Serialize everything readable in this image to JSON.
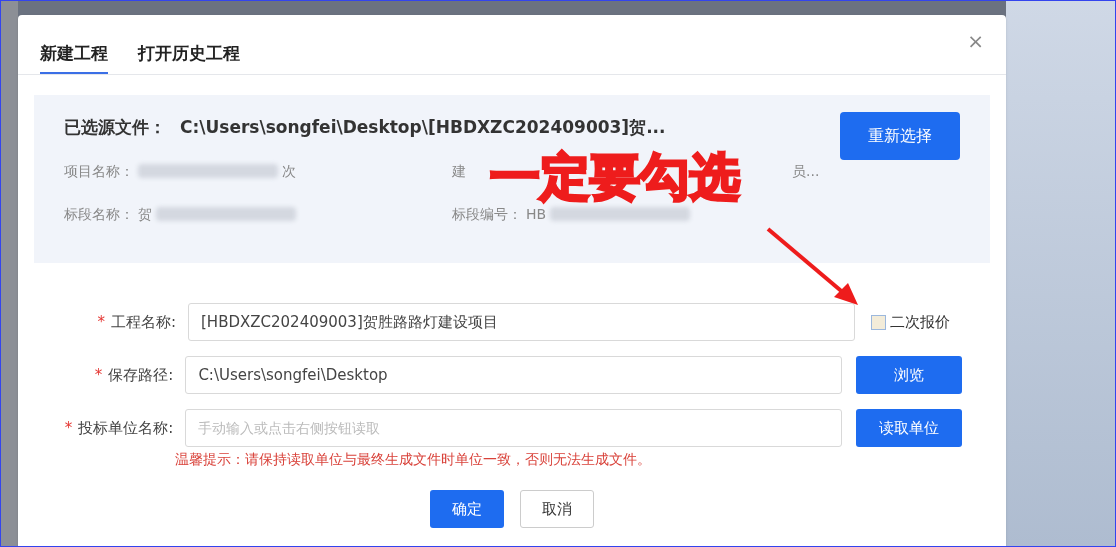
{
  "tabs": [
    {
      "label": "新建工程",
      "selected": true
    },
    {
      "label": "打开历史工程",
      "selected": false
    }
  ],
  "source_file": {
    "label": "已选源文件：",
    "path": "C:\\Users\\songfei\\Desktop\\[HBDXZC202409003]贺...",
    "button": "重新选择"
  },
  "info": [
    {
      "label": "项目名称：",
      "value_end": "次",
      "kind": "blurred"
    },
    {
      "label": "建",
      "value_end": "员...",
      "kind": "covered"
    },
    {
      "label": "标段名称：",
      "value_start": "贺",
      "kind": "blurred"
    },
    {
      "label": "标段编号：",
      "value_start": "HB",
      "kind": "blurred"
    }
  ],
  "annotation": {
    "text": "一定要勾选"
  },
  "form": [
    {
      "label": "工程名称:",
      "mark": "*",
      "value": "[HBDXZC202409003]贺胜路路灯建设项目",
      "kind": "checkbox",
      "action": "二次报价",
      "checked": false
    },
    {
      "label": "保存路径:",
      "mark": "*",
      "value": "C:\\Users\\songfei\\Desktop",
      "kind": "button",
      "action": "浏览"
    },
    {
      "label": "投标单位名称:",
      "mark": "*",
      "placeholder": "手动输入或点击右侧按钮读取",
      "kind": "button",
      "action": "读取单位"
    }
  ],
  "hint": "温馨提示：请保持读取单位与最终生成文件时单位一致，否则无法生成文件。",
  "buttons": [
    {
      "label": "确定",
      "kind": "primary"
    },
    {
      "label": "取消",
      "kind": "secondary"
    }
  ],
  "close": "×"
}
